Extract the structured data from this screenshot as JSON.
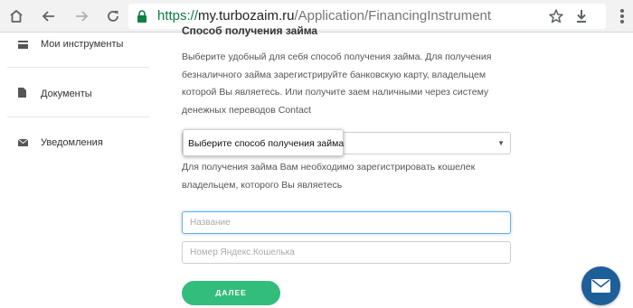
{
  "browser": {
    "url_scheme": "https://",
    "url_host": "my.turbozaim.ru",
    "url_path": "/Application/FinancingInstrument",
    "icons": [
      "home-icon",
      "back-icon",
      "forward-icon",
      "reload-icon",
      "lock-icon",
      "star-icon",
      "download-icon",
      "menu-icon"
    ],
    "secure_color": "#0b8043"
  },
  "sidebar": {
    "items": [
      {
        "label": "Мои инструменты",
        "icon": "card-icon"
      },
      {
        "label": "Документы",
        "icon": "document-icon"
      },
      {
        "label": "Уведомления",
        "icon": "envelope-icon"
      }
    ]
  },
  "main": {
    "section_title": "Способ получения займа",
    "intro": "Выберите удобный для себя способ получения займа. Для получения безналичного займа зарегистрируйте банковскую карту, владельцем которой Вы являетесь. Или получите заем наличными через систему денежных переводов Contact",
    "method_select": {
      "value": ""
    },
    "tooltip": "Выберите способ получения займа",
    "wallet_text": "Для получения займа Вам необходимо зарегистрировать кошелек владельцем, которого Вы являетесь",
    "name_field": {
      "placeholder": "Название",
      "value": ""
    },
    "wallet_field": {
      "placeholder": "Номер Яндекс.Кошелька",
      "value": ""
    },
    "submit_label": "ДАЛЕЕ",
    "accent_color": "#32bd7c"
  },
  "chat": {
    "icon": "mail-icon",
    "color": "#1d5f99"
  }
}
